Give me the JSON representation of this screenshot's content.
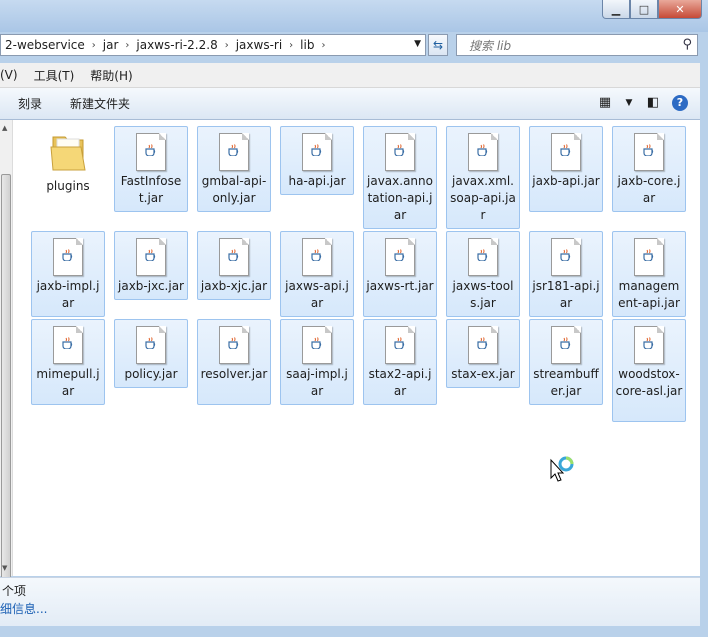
{
  "address": {
    "crumbs": [
      "2-webservice",
      "jar",
      "jaxws-ri-2.2.8",
      "jaxws-ri",
      "lib"
    ]
  },
  "search": {
    "placeholder": "搜索 lib"
  },
  "menu": [
    "(V)",
    "工具(T)",
    "帮助(H)"
  ],
  "commands": [
    "刻录",
    "新建文件夹"
  ],
  "icons": {
    "refresh": "refresh-icon",
    "search": "search-icon",
    "views": "view-options-icon",
    "preview": "preview-pane-icon",
    "help": "help-icon",
    "folder": "folder-icon",
    "jar": "java-jar-file-icon",
    "cursor": "busy-cursor-icon"
  },
  "colors": {
    "selection": "#d6e8fb",
    "selection_border": "#9dc4ef",
    "link": "#1a5fb4"
  },
  "files": [
    "plugins",
    "FastInfoset.jar",
    "gmbal-api-only.jar",
    "ha-api.jar",
    "javax.annotation-api.jar",
    "javax.xml.soap-api.jar",
    "jaxb-api.jar",
    "jaxb-core.jar",
    "jaxb-impl.jar",
    "jaxb-jxc.jar",
    "jaxb-xjc.jar",
    "jaxws-api.jar",
    "jaxws-rt.jar",
    "jaxws-tools.jar",
    "jsr181-api.jar",
    "management-api.jar",
    "mimepull.jar",
    "policy.jar",
    "resolver.jar",
    "saaj-impl.jar",
    "stax2-api.jar",
    "stax-ex.jar",
    "streambuffer.jar",
    "woodstox-core-asl.jar"
  ],
  "status": {
    "count": "个项",
    "details": "细信息..."
  }
}
